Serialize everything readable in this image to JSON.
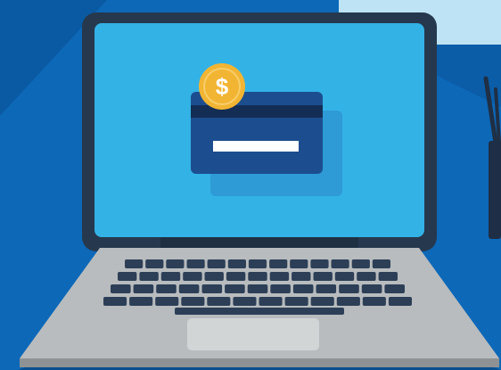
{
  "scene": {
    "description_icons": [
      "laptop-icon",
      "credit-card-icon",
      "dollar-coin-icon",
      "pen-holder-icon"
    ]
  },
  "coin": {
    "symbol": "$"
  },
  "colors": {
    "background": "#0d68b8",
    "background_dark": "#0a5aa3",
    "background_light_panel": "#bde3f5",
    "screen": "#33b2e6",
    "bezel": "#26384d",
    "card": "#1c4e8f",
    "card_stripe": "#132d55",
    "coin": "#f2b533",
    "laptop_base": "#b8bcbe",
    "keys": "#2d3f57"
  }
}
